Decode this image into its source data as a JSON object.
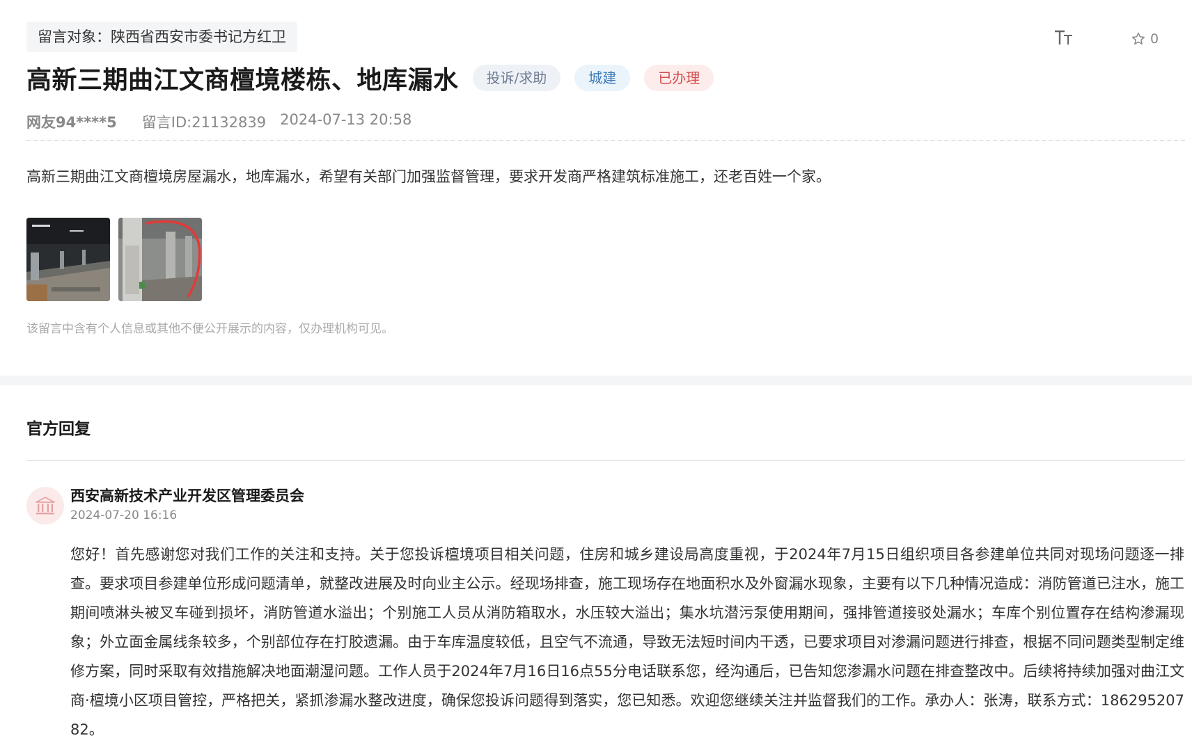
{
  "message": {
    "recipient_label": "留言对象：陕西省西安市委书记方红卫",
    "title": "高新三期曲江文商檀境楼栋、地库漏水",
    "tags": {
      "type": "投诉/求助",
      "category": "城建",
      "status": "已办理"
    },
    "author": "网友94****5",
    "message_id": "留言ID:21132839",
    "time": "2024-07-13 20:58",
    "content": "高新三期曲江文商檀境房屋漏水，地库漏水，希望有关部门加强监督管理，要求开发商严格建筑标准施工，还老百姓一个家。",
    "privacy_note": "该留言中含有个人信息或其他不便公开展示的内容，仅办理机构可见。",
    "favorite_count": "0"
  },
  "icons": {
    "font_size": "text-size-icon",
    "favorite": "star-outline-icon",
    "org": "government-building-icon"
  },
  "colors": {
    "tag_status": "#d44a4a",
    "tag_category": "#3b78b8",
    "tag_type": "#6d7a92"
  },
  "reply": {
    "section_title": "官方回复",
    "org_name": "西安高新技术产业开发区管理委员会",
    "time": "2024-07-20 16:16",
    "body": "您好！首先感谢您对我们工作的关注和支持。关于您投诉檀境项目相关问题，住房和城乡建设局高度重视，于2024年7月15日组织项目各参建单位共同对现场问题逐一排查。要求项目参建单位形成问题清单，就整改进展及时向业主公示。经现场排查，施工现场存在地面积水及外窗漏水现象，主要有以下几种情况造成：消防管道已注水，施工期间喷淋头被叉车碰到损坏，消防管道水溢出；个别施工人员从消防箱取水，水压较大溢出；集水坑潜污泵使用期间，强排管道接驳处漏水；车库个别位置存在结构渗漏现象；外立面金属线条较多，个别部位存在打胶遗漏。由于车库温度较低，且空气不流通，导致无法短时间内干透，已要求项目对渗漏问题进行排查，根据不同问题类型制定维修方案，同时采取有效措施解决地面潮湿问题。工作人员于2024年7月16日16点55分电话联系您，经沟通后，已告知您渗漏水问题在排查整改中。后续将持续加强对曲江文商·檀境小区项目管控，严格把关，紧抓渗漏水整改进度，确保您投诉问题得到落实，您已知悉。欢迎您继续关注并监督我们的工作。承办人：张涛，联系方式：18629520782。"
  }
}
